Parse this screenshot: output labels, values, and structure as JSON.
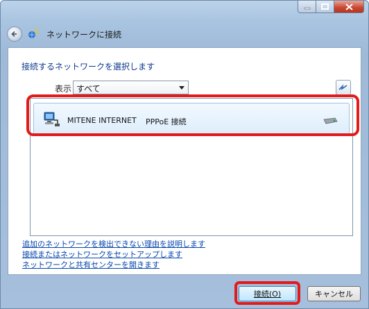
{
  "window": {
    "title": "ネットワークに接続"
  },
  "main": {
    "instruction": "接続するネットワークを選択します",
    "show_label": "表示",
    "show_value": "すべて"
  },
  "networks": [
    {
      "name": "MITENE INTERNET",
      "type": "PPPoE 接続"
    }
  ],
  "links": [
    "追加のネットワークを検出できない理由を説明します",
    "接続またはネットワークをセットアップします",
    "ネットワークと共有センターを開きます"
  ],
  "buttons": {
    "connect": "接続(O)",
    "cancel": "キャンセル"
  },
  "colors": {
    "annotation_highlight": "#e21a1a",
    "link": "#0645ad",
    "caption_close": "#c8462f"
  }
}
